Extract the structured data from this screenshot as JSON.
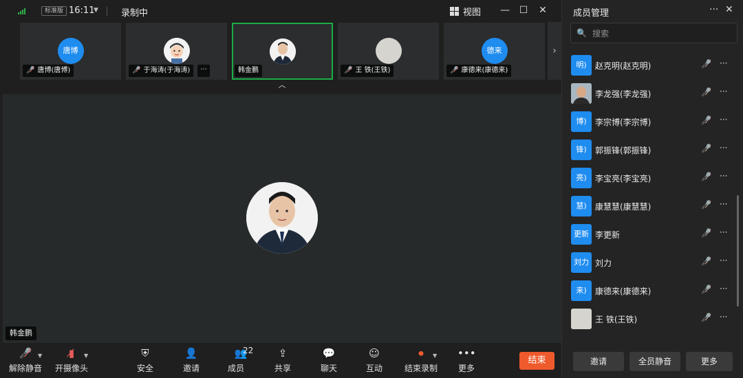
{
  "topbar": {
    "version_badge": "标准版",
    "time": "16:11",
    "recording": "录制中",
    "view_label": "视图",
    "signal_color": "#2fb04a"
  },
  "thumbnails": [
    {
      "avatar_text": "唐博",
      "name": "唐博(唐博)",
      "muted": true,
      "active": false,
      "avatar_type": "text"
    },
    {
      "avatar_text": "",
      "name": "于海涛(于海涛)",
      "muted": true,
      "active": false,
      "avatar_type": "cartoon",
      "has_more": true
    },
    {
      "avatar_text": "",
      "name": "韩金鹏",
      "muted": false,
      "active": true,
      "avatar_type": "photo"
    },
    {
      "avatar_text": "",
      "name": "王  铁(王铁)",
      "muted": true,
      "active": false,
      "avatar_type": "gray"
    },
    {
      "avatar_text": "德来",
      "name": "康德来(康德来)",
      "muted": true,
      "active": false,
      "avatar_type": "text"
    }
  ],
  "main": {
    "speaker_name": "韩金鹏"
  },
  "toolbar": {
    "unmute": "解除静音",
    "camera": "开摄像头",
    "security": "安全",
    "invite": "邀请",
    "members": "成员",
    "members_count": "22",
    "share": "共享",
    "chat": "聊天",
    "interact": "互动",
    "stop_record": "结束录制",
    "more": "更多",
    "end": "结束",
    "end_color": "#ef5a2c"
  },
  "panel": {
    "title": "成员管理",
    "search_placeholder": "搜索",
    "members": [
      {
        "avatar_text": "明)",
        "name": "赵克明(赵克明)",
        "avatar_type": "text"
      },
      {
        "avatar_text": "",
        "name": "李龙强(李龙强)",
        "avatar_type": "photo"
      },
      {
        "avatar_text": "博)",
        "name": "李宗博(李宗博)",
        "avatar_type": "text"
      },
      {
        "avatar_text": "锋)",
        "name": "郭振锋(郭振锋)",
        "avatar_type": "text"
      },
      {
        "avatar_text": "亮)",
        "name": "李宝亮(李宝亮)",
        "avatar_type": "text"
      },
      {
        "avatar_text": "慧)",
        "name": "康慧慧(康慧慧)",
        "avatar_type": "text"
      },
      {
        "avatar_text": "更新",
        "name": "李更新",
        "avatar_type": "text"
      },
      {
        "avatar_text": "刘力",
        "name": "刘力",
        "avatar_type": "text"
      },
      {
        "avatar_text": "来)",
        "name": "康德来(康德来)",
        "avatar_type": "text"
      },
      {
        "avatar_text": "",
        "name": "王  铁(王铁)",
        "avatar_type": "gray"
      }
    ],
    "invite": "邀请",
    "mute_all": "全员静音",
    "more": "更多",
    "accent_color": "#1f8cf0"
  }
}
